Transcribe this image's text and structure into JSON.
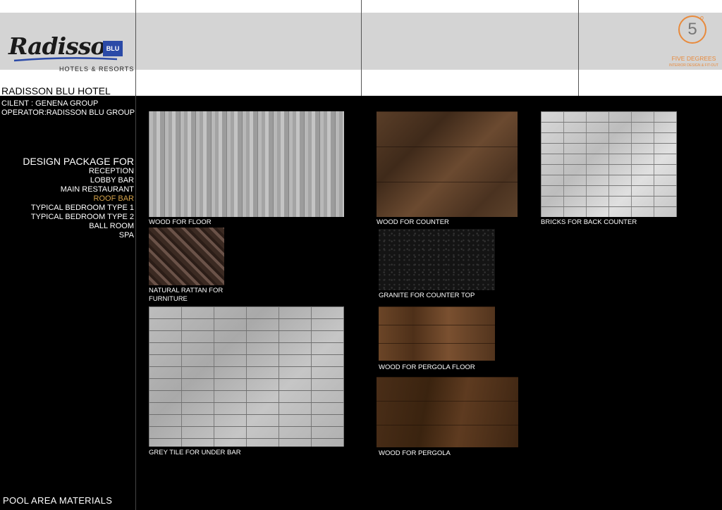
{
  "header": {
    "brand_word": "Radisson",
    "brand_badge": "BLU",
    "brand_tagline": "HOTELS & RESORTS",
    "partner_numeral": "5",
    "partner_degree": "o",
    "partner_name": "FIVE DEGREES",
    "partner_subtitle": "INTERIOR DESIGN & FIT-OUT"
  },
  "project": {
    "title": "RADISSON BLU HOTEL",
    "client": "CILENT : GENENA GROUP",
    "operator": "OPERATOR:RADISSON BLU GROUP"
  },
  "package": {
    "title": "DESIGN PACKAGE FOR",
    "items": [
      {
        "label": "RECEPTION",
        "active": false
      },
      {
        "label": "LOBBY BAR",
        "active": false
      },
      {
        "label": "MAIN RESTAURANT",
        "active": false
      },
      {
        "label": "ROOF BAR",
        "active": true
      },
      {
        "label": "TYPICAL BEDROOM TYPE 1",
        "active": false
      },
      {
        "label": "TYPICAL BEDROOM TYPE 2",
        "active": false
      },
      {
        "label": "BALL ROOM",
        "active": false
      },
      {
        "label": "SPA",
        "active": false
      }
    ],
    "active_color": "#d4a24a"
  },
  "materials": {
    "wood_floor": "WOOD FOR FLOOR",
    "wood_counter": "WOOD FOR COUNTER",
    "bricks": "BRICKS FOR BACK COUNTER",
    "rattan_line1": "NATURAL RATTAN FOR",
    "rattan_line2": "FURNITURE",
    "granite": "GRANITE FOR COUNTER TOP",
    "grey_tile": "GREY TILE FOR UNDER BAR",
    "pergola_floor": "WOOD FOR PERGOLA FLOOR",
    "pergola": "WOOD FOR PERGOLA"
  },
  "footer": {
    "title": "POOL AREA MATERIALS"
  },
  "colors": {
    "background": "#000000",
    "header_band": "#d4d4d4",
    "partner_accent": "#e88a3c",
    "brand_blue": "#2b4aa7"
  }
}
